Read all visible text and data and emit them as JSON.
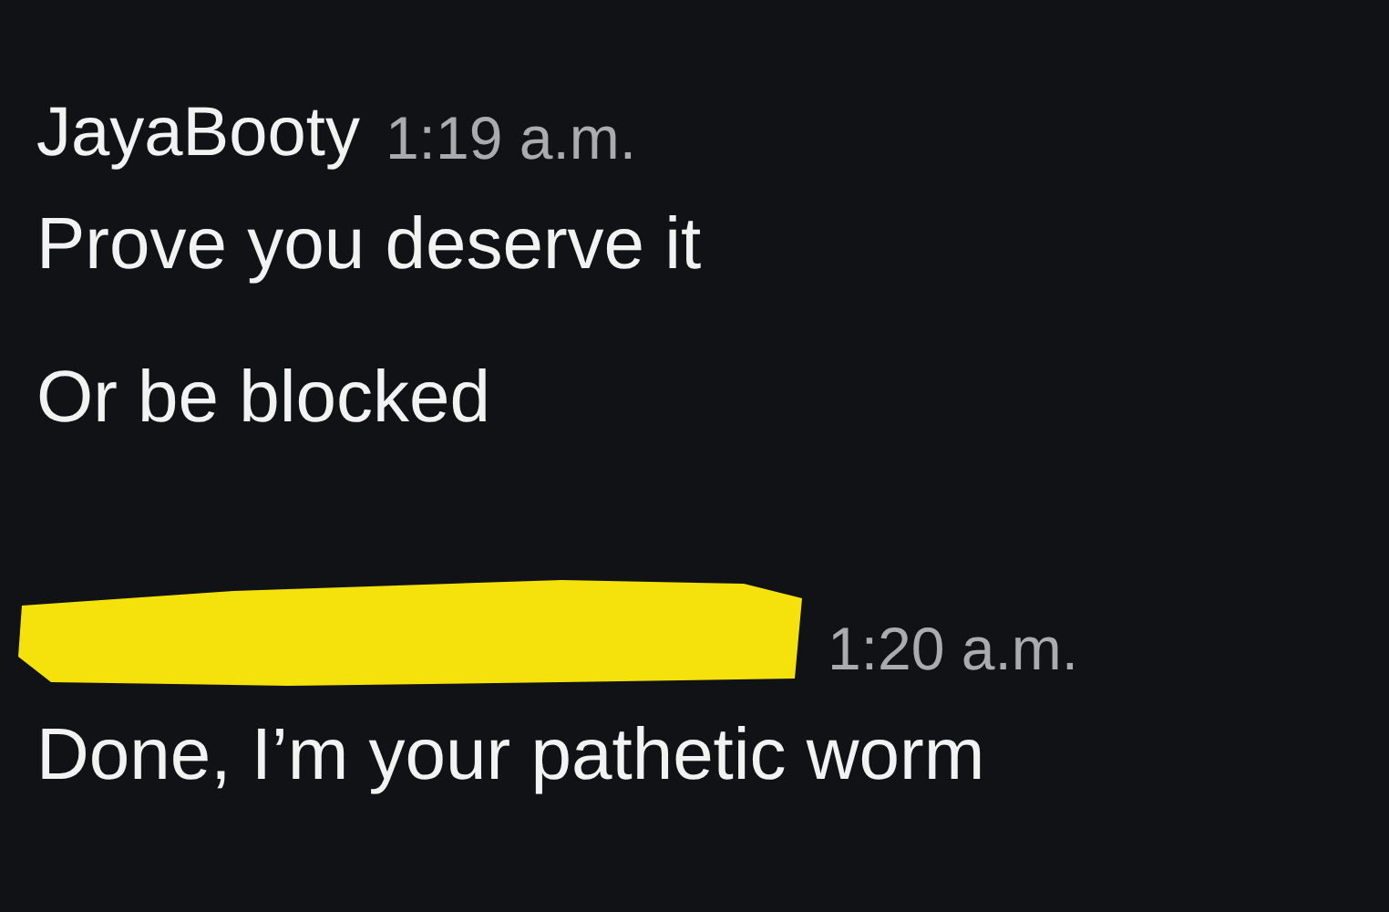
{
  "messages": [
    {
      "author": "JayaBooty",
      "redacted": false,
      "time": "1:19 a.m.",
      "lines": [
        "Prove you deserve it",
        "Or be blocked"
      ]
    },
    {
      "redacted": true,
      "time": "1:20 a.m.",
      "lines": [
        "Done, I’m your pathetic worm"
      ]
    }
  ]
}
